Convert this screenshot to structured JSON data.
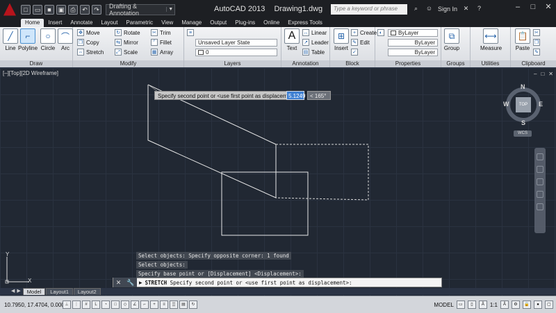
{
  "titlebar": {
    "workspace": "Drafting & Annotation",
    "app_name": "AutoCAD 2013",
    "document": "Drawing1.dwg",
    "search_placeholder": "Type a keyword or phrase",
    "signin": "Sign In"
  },
  "ribbon_tabs": [
    "Home",
    "Insert",
    "Annotate",
    "Layout",
    "Parametric",
    "View",
    "Manage",
    "Output",
    "Plug-ins",
    "Online",
    "Express Tools"
  ],
  "ribbon": {
    "draw": {
      "title": "Draw",
      "line": "Line",
      "polyline": "Polyline",
      "circle": "Circle",
      "arc": "Arc"
    },
    "modify": {
      "title": "Modify",
      "move": "Move",
      "rotate": "Rotate",
      "trim": "Trim",
      "copy": "Copy",
      "mirror": "Mirror",
      "fillet": "Fillet",
      "stretch": "Stretch",
      "scale": "Scale",
      "array": "Array"
    },
    "layers": {
      "title": "Layers",
      "state": "Unsaved Layer State",
      "current": "0"
    },
    "annotation": {
      "title": "Annotation",
      "text": "Text",
      "linear": "Linear",
      "leader": "Leader",
      "table": "Table"
    },
    "block": {
      "title": "Block",
      "insert": "Insert",
      "create": "Create",
      "edit": "Edit"
    },
    "properties": {
      "title": "Properties",
      "color": "ByLayer",
      "linetype": "ByLayer",
      "lineweight": "ByLayer"
    },
    "groups": {
      "title": "Groups",
      "group": "Group"
    },
    "utilities": {
      "title": "Utilities",
      "measure": "Measure"
    },
    "clipboard": {
      "title": "Clipboard",
      "paste": "Paste"
    }
  },
  "viewport": {
    "label": "[–][Top][2D Wireframe]",
    "tooltip": "Specify second point or <use first point as displacement>",
    "dyn_distance": "5.1249",
    "dyn_angle": "< 165°",
    "viewcube": {
      "n": "N",
      "s": "S",
      "e": "E",
      "w": "W",
      "face": "TOP",
      "wcs": "WCS"
    },
    "ucs_y": "Y",
    "ucs_x": "X"
  },
  "command_history": [
    "Select objects: Specify opposite corner: 1 found",
    "Select objects:",
    "Specify base point or [Displacement] <Displacement>:"
  ],
  "command_line": {
    "command": "STRETCH",
    "prompt": "Specify second point or <use first point as displacement>:"
  },
  "layout_tabs": [
    "Model",
    "Layout1",
    "Layout2"
  ],
  "statusbar": {
    "coords": "10.7950, 17.4704, 0.0000",
    "space": "MODEL",
    "scale": "1:1"
  },
  "colors": {
    "viewport_bg": "#212833",
    "geometry": "#e8e8e8",
    "dyn_input": "#3e7fd2"
  }
}
